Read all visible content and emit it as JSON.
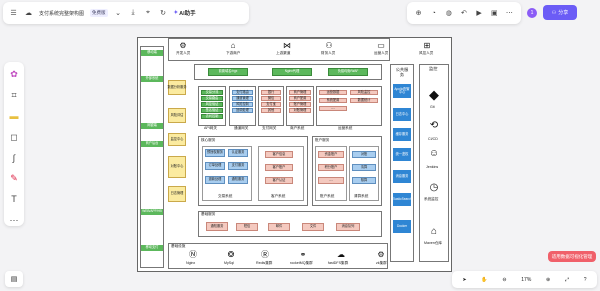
{
  "topbar": {
    "doc_title": "支付系统完整架构图",
    "badge": "免费版",
    "ai_label": "AI助手"
  },
  "share": {
    "label": "分享",
    "avatar": "1"
  },
  "zoom": "17%",
  "promo": "适用数据可视化管理",
  "left_labels": [
    "移动端",
    "外部系统",
    "网银端",
    "商户后台",
    "WEB/APP/H5",
    "移动支付"
  ],
  "top_row": [
    "开发人员",
    "下游商户",
    "上游渠道",
    "财务人员",
    "运营人员",
    "风控人员"
  ],
  "domains": [
    "前置域名/ngx",
    "Nginx代理",
    "负载均衡/WAF"
  ],
  "gateways": {
    "api": {
      "title": "API网关",
      "items": [
        "交易分流",
        "交易路由",
        "风控验证",
        "签名验证",
        "访问控制"
      ]
    },
    "yellow": {
      "title": "",
      "items": [
        "数据加密解密",
        "安全认证服务",
        "协议转换"
      ]
    },
    "route": {
      "title": "通道网关",
      "items": [
        "支付路由",
        "通道管理",
        "风险控制",
        "回调处理"
      ]
    },
    "pay": {
      "title": "支付网关",
      "items": [
        "银行",
        "微信",
        "支付宝",
        "其他"
      ]
    },
    "merchant": {
      "title": "商户系统",
      "items": [
        "商户管理",
        "商户配置",
        "账户管理",
        "对账管理"
      ]
    },
    "ops": {
      "title": "运营系统",
      "items": [
        "运营数据",
        "风险监控",
        "系统配置",
        "数据统计",
        "....."
      ]
    }
  },
  "core": {
    "title": "核心服务",
    "trade": {
      "title": "交易系统",
      "items": [
        "预授权服务",
        "认证服务",
        "订单处理",
        "支付服务",
        "退款处理",
        "通知服务"
      ]
    },
    "client": {
      "title": "客户系统",
      "items": [
        "客户信息",
        "客户账户",
        "客户认证"
      ]
    },
    "left_yellow": [
      "数据分析服务",
      "风险评估",
      "监控中心",
      "对账中心",
      "日志管理"
    ]
  },
  "account": {
    "title": "账户服务",
    "sys": {
      "title": "账户系统",
      "items": [
        "资金账户",
        "积分账户",
        "....."
      ]
    },
    "settle": {
      "title": "清算系统",
      "items": [
        "对账",
        "清算",
        "核算"
      ]
    }
  },
  "base": {
    "title": "基础服务",
    "items": [
      "通知服务",
      "短信",
      "邮件",
      "文件",
      "消息队列"
    ]
  },
  "middleware": {
    "title": "基础设施",
    "items": [
      "Nginx",
      "MySql",
      "Redis集群",
      "rocketMQ集群",
      "fastDFS集群",
      "zk集群"
    ]
  },
  "public": {
    "title": "公共服务",
    "items": [
      "Apollo配置中心",
      "日志中心",
      "缓存服务",
      "统一鉴权",
      "消息服务",
      "ElasticSearch",
      "Docker"
    ]
  },
  "monitor": {
    "title": "监控",
    "items": [
      "Git",
      "CI/CD",
      "Jenkins",
      "系统监控",
      "Maven仓库"
    ]
  }
}
